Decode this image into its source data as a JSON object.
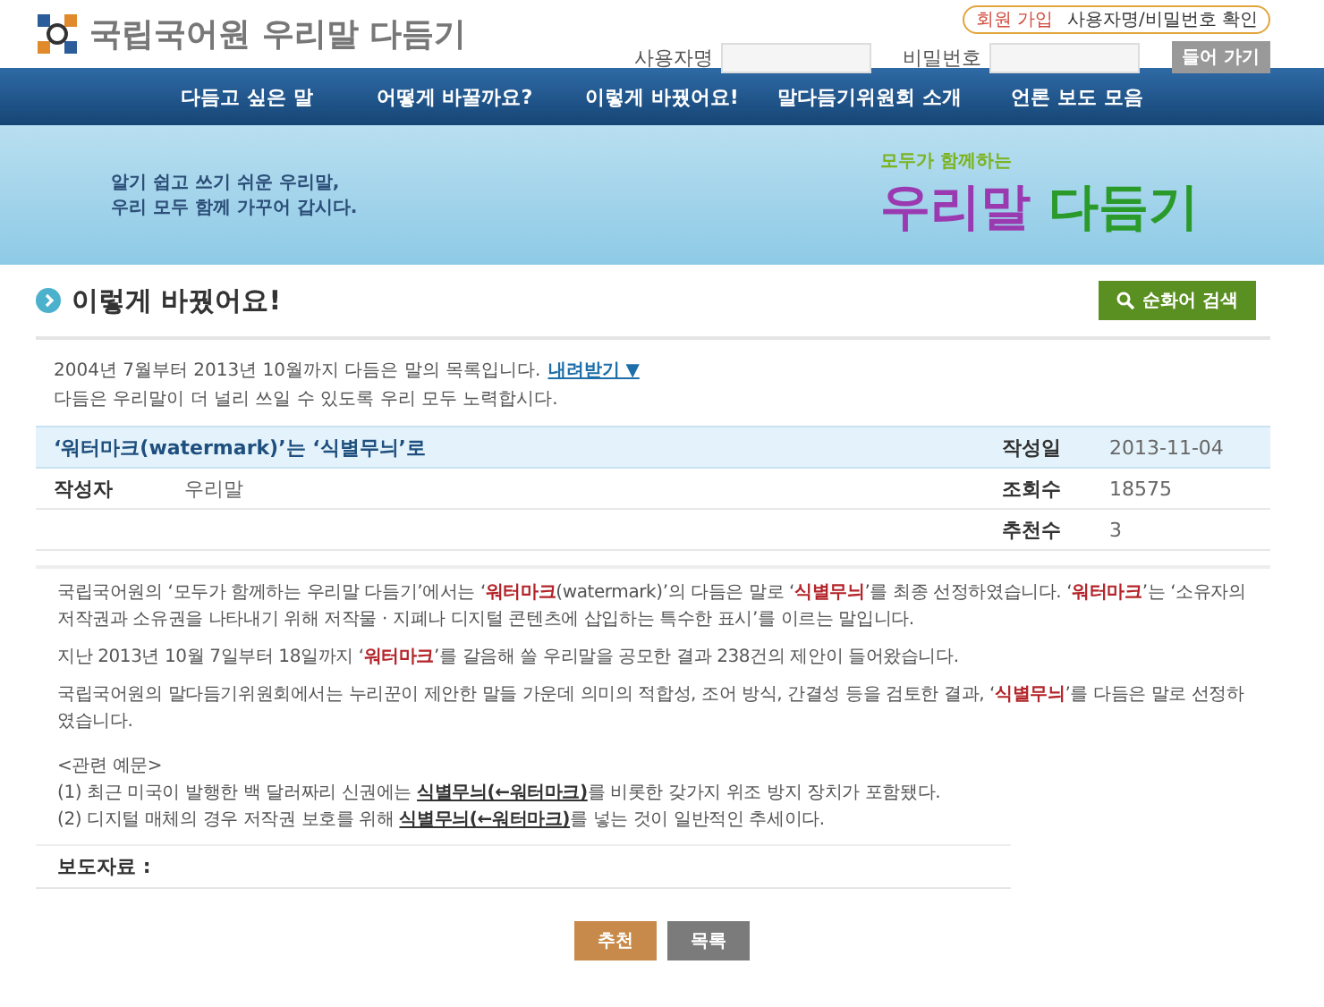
{
  "header": {
    "site_title": "국립국어원 우리말 다듬기",
    "join_link": "회원 가입",
    "find_link": "사용자명/비밀번호 확인",
    "username_label": "사용자명",
    "password_label": "비밀번호",
    "login_button": "들어 가기"
  },
  "nav": [
    "다듬고 싶은 말",
    "어떻게 바꿀까요?",
    "이렇게 바꿨어요!",
    "말다듬기위원회 소개",
    "언론 보도 모음"
  ],
  "banner": {
    "slogan_line_1": "알기 쉽고 쓰기 쉬운 우리말,",
    "slogan_line_2": "우리 모두 함께 가꾸어 갑시다.",
    "subtitle": "모두가 함께하는",
    "title_part_1": "우리말",
    "title_part_2": "다듬기"
  },
  "page_title": "이렇게 바꿨어요!",
  "search_button": "순화어 검색",
  "intro": {
    "line_1": "2004년 7월부터 2013년 10월까지 다듬은 말의 목록입니다.",
    "download_link": "내려받기 ▼",
    "line_2": "다듬은 우리말이 더 널리 쓰일 수 있도록 우리 모두 노력합시다."
  },
  "article": {
    "title": "‘워터마크(watermark)’는 ‘식별무늬’로",
    "date_label": "작성일",
    "date": "2013-11-04",
    "author_label": "작성자",
    "author": "우리말",
    "views_label": "조회수",
    "views": "18575",
    "recommend_label": "추천수",
    "recommends": "3",
    "paragraphs": [
      "국립국어원의 ‘모두가 함께하는 우리말 다듬기’에서는 ‘**워터마크**(watermark)’의 다듬은 말로 ‘**식별무늬**’를 최종 선정하였습니다. ‘**워터마크**’는 ‘소유자의 저작권과 소유권을 나타내기 위해 저작물 · 지폐나 디지털 콘텐츠에 삽입하는 특수한 표시’를 이르는 말입니다.",
      "지난 2013년 10월 7일부터 18일까지 ‘**워터마크**’를 갈음해 쓸 우리말을 공모한 결과 238건의 제안이 들어왔습니다.",
      "국립국어원의 말다듬기위원회에서는 누리꾼이 제안한 말들 가운데 의미의 적합성, 조어 방식, 간결성 등을 검토한 결과, ‘**식별무늬**’를 다듬은 말로 선정하였습니다."
    ],
    "examples_heading": "<관련 예문>",
    "examples": [
      "(1) 최근 미국이 발행한 백 달러짜리 신권에는 **식별무늬(←워터마크)**를 비롯한 갖가지 위조 방지 장치가 포함됐다.",
      "(2) 디지털 매체의 경우 저작권 보호를 위해 **식별무늬(←워터마크)**를 넣는 것이 일반적인 추세이다."
    ],
    "press_label": "보도자료 :"
  },
  "buttons": [
    "추천",
    "목록"
  ]
}
